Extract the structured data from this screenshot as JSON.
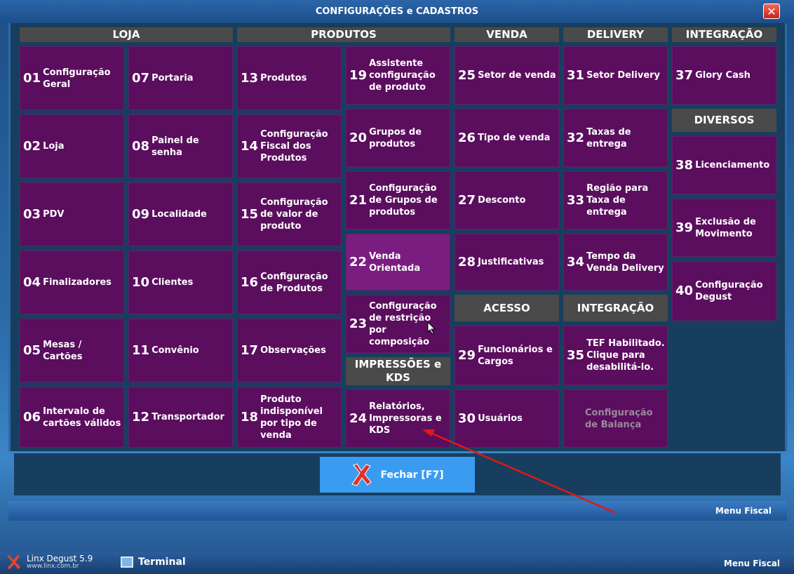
{
  "window": {
    "title": "CONFIGURAÇÕES e CADASTROS"
  },
  "headers": {
    "loja": "LOJA",
    "produtos": "PRODUTOS",
    "venda": "VENDA",
    "delivery": "DELIVERY",
    "integracao1": "INTEGRAÇÃO",
    "diversos": "DIVERSOS",
    "acesso": "ACESSO",
    "integracao2": "INTEGRAÇÃO",
    "impressoes": "IMPRESSÕES e KDS"
  },
  "tiles": {
    "t01": {
      "num": "01",
      "label": "Configuração Geral"
    },
    "t02": {
      "num": "02",
      "label": "Loja"
    },
    "t03": {
      "num": "03",
      "label": "PDV"
    },
    "t04": {
      "num": "04",
      "label": "Finalizadores"
    },
    "t05": {
      "num": "05",
      "label": "Mesas / Cartões"
    },
    "t06": {
      "num": "06",
      "label": "Intervalo de cartões válidos"
    },
    "t07": {
      "num": "07",
      "label": "Portaria"
    },
    "t08": {
      "num": "08",
      "label": "Painel de senha"
    },
    "t09": {
      "num": "09",
      "label": "Localidade"
    },
    "t10": {
      "num": "10",
      "label": "Clientes"
    },
    "t11": {
      "num": "11",
      "label": "Convênio"
    },
    "t12": {
      "num": "12",
      "label": "Transportador"
    },
    "t13": {
      "num": "13",
      "label": "Produtos"
    },
    "t14": {
      "num": "14",
      "label": "Configuração Fiscal dos Produtos"
    },
    "t15": {
      "num": "15",
      "label": "Configuração de valor de produto"
    },
    "t16": {
      "num": "16",
      "label": "Configuração de Produtos"
    },
    "t17": {
      "num": "17",
      "label": "Observações"
    },
    "t18": {
      "num": "18",
      "label": "Produto indisponível por tipo de venda"
    },
    "t19": {
      "num": "19",
      "label": "Assistente configuração de produto"
    },
    "t20": {
      "num": "20",
      "label": "Grupos de produtos"
    },
    "t21": {
      "num": "21",
      "label": "Configuração de Grupos de produtos"
    },
    "t22": {
      "num": "22",
      "label": "Venda Orientada"
    },
    "t23": {
      "num": "23",
      "label": "Configuração de restrição por composição"
    },
    "t24": {
      "num": "24",
      "label": "Relatórios, Impressoras e KDS"
    },
    "t25": {
      "num": "25",
      "label": "Setor de venda"
    },
    "t26": {
      "num": "26",
      "label": "Tipo de venda"
    },
    "t27": {
      "num": "27",
      "label": "Desconto"
    },
    "t28": {
      "num": "28",
      "label": "Justificativas"
    },
    "t29": {
      "num": "29",
      "label": "Funcionários e Cargos"
    },
    "t30": {
      "num": "30",
      "label": "Usuários"
    },
    "t31": {
      "num": "31",
      "label": "Setor Delivery"
    },
    "t32": {
      "num": "32",
      "label": "Taxas de entrega"
    },
    "t33": {
      "num": "33",
      "label": "Região para Taxa de entrega"
    },
    "t34": {
      "num": "34",
      "label": "Tempo da Venda Delivery"
    },
    "t35": {
      "num": "35",
      "label": "TEF Habilitado. Clique para desabilitá-lo."
    },
    "tbal": {
      "num": "",
      "label": "Configuração de Balança"
    },
    "t37": {
      "num": "37",
      "label": "Glory Cash"
    },
    "t38": {
      "num": "38",
      "label": "Licenciamento"
    },
    "t39": {
      "num": "39",
      "label": "Exclusão de Movimento"
    },
    "t40": {
      "num": "40",
      "label": "Configuração Degust"
    }
  },
  "footer": {
    "close_label": "Fechar [F7]",
    "menu_fiscal": "Menu Fiscal"
  },
  "taskbar": {
    "app_name": "Linx Degust 5.9",
    "app_site": "www.linx.com.br",
    "terminal": "Terminal",
    "menu_fiscal": "Menu Fiscal"
  },
  "colors": {
    "tile": "#5b0d5e",
    "tile_highlight": "#7a1d80",
    "header": "#4a4a4a",
    "close_button": "#3a9cf0"
  }
}
